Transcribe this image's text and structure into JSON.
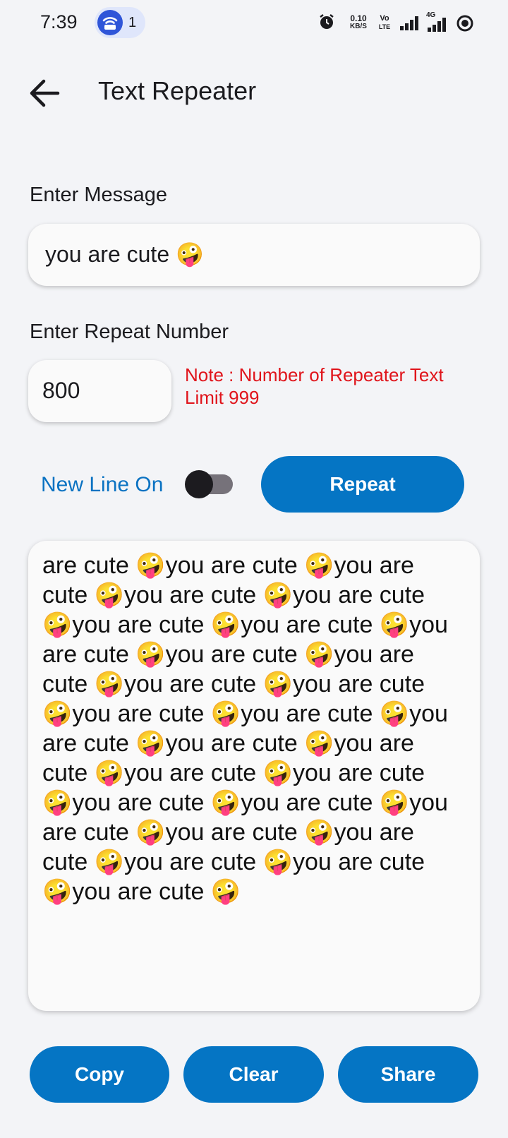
{
  "status_bar": {
    "time": "7:39",
    "hotspot_count": "1",
    "net_speed_value": "0.10",
    "net_speed_unit": "KB/S",
    "volte_top": "Vo",
    "volte_bottom": "LTE",
    "network_type": "4G"
  },
  "app_bar": {
    "title": "Text Repeater"
  },
  "message": {
    "label": "Enter Message",
    "value": "you are cute 🤪"
  },
  "repeat": {
    "label": "Enter Repeat Number",
    "value": "800",
    "note": "Note : Number of Repeater Text Limit 999"
  },
  "options": {
    "newline_label": "New Line On",
    "newline_enabled": false,
    "repeat_button": "Repeat"
  },
  "output": {
    "text": "are cute 🤪you are cute 🤪you are cute 🤪you are cute 🤪you are cute 🤪you are cute 🤪you are cute 🤪you are cute 🤪you are cute 🤪you are cute 🤪you are cute 🤪you are cute 🤪you are cute 🤪you are cute 🤪you are cute 🤪you are cute 🤪you are cute 🤪you are cute 🤪you are cute 🤪you are cute 🤪you are cute 🤪you are cute 🤪you are cute 🤪you are cute 🤪you are cute 🤪you are cute 🤪you are cute 🤪"
  },
  "actions": {
    "copy": "Copy",
    "clear": "Clear",
    "share": "Share"
  },
  "colors": {
    "accent": "#0575c4",
    "note": "#e0141b",
    "background": "#f3f4f7"
  }
}
